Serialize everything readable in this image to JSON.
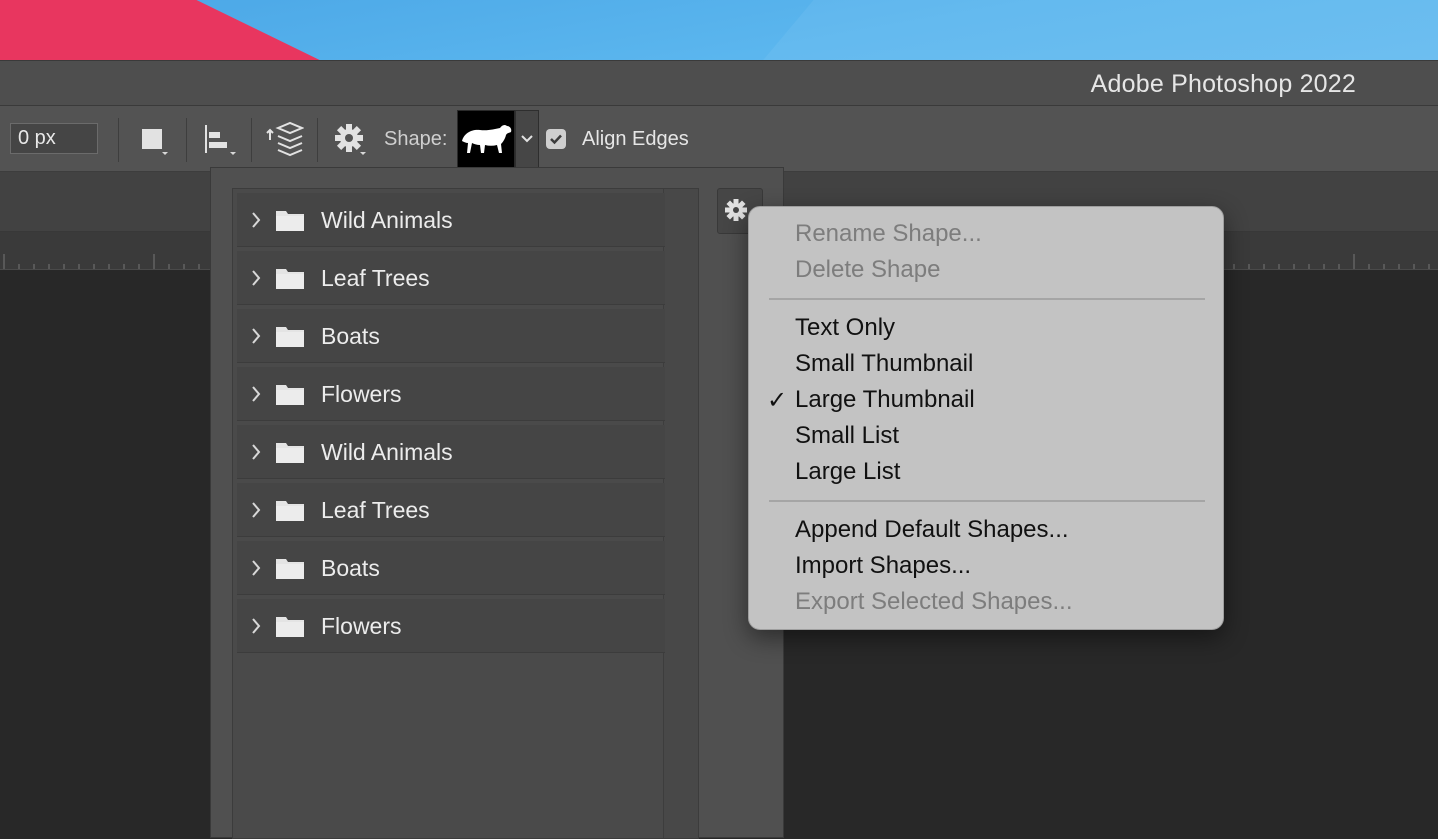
{
  "app": {
    "title": "Adobe Photoshop 2022"
  },
  "options_bar": {
    "radius_value": "0 px",
    "shape_label": "Shape:",
    "align_edges_label": "Align Edges",
    "align_edges_checked": true,
    "tool_icons": [
      "fill-square-icon",
      "align-left-icon",
      "arrange-layers-icon",
      "gear-icon"
    ]
  },
  "shape_picker": {
    "groups": [
      {
        "label": "Wild Animals"
      },
      {
        "label": "Leaf Trees"
      },
      {
        "label": "Boats"
      },
      {
        "label": "Flowers"
      },
      {
        "label": "Wild Animals"
      },
      {
        "label": "Leaf Trees"
      },
      {
        "label": "Boats"
      },
      {
        "label": "Flowers"
      }
    ]
  },
  "context_menu": {
    "items": [
      {
        "label": "Rename Shape...",
        "enabled": false
      },
      {
        "label": "Delete Shape",
        "enabled": false
      },
      {
        "label": "Text Only",
        "enabled": true
      },
      {
        "label": "Small Thumbnail",
        "enabled": true
      },
      {
        "label": "Large Thumbnail",
        "enabled": true,
        "checked": true
      },
      {
        "label": "Small List",
        "enabled": true
      },
      {
        "label": "Large List",
        "enabled": true
      },
      {
        "label": "Append Default Shapes...",
        "enabled": true
      },
      {
        "label": "Import Shapes...",
        "enabled": true
      },
      {
        "label": "Export Selected Shapes...",
        "enabled": false
      }
    ],
    "check_glyph": "✓"
  },
  "colors": {
    "panel": "#505050",
    "menu_bg": "#c3c3c3",
    "desktop_blue": "#5bb6ee",
    "desktop_pink": "#e8365f"
  }
}
